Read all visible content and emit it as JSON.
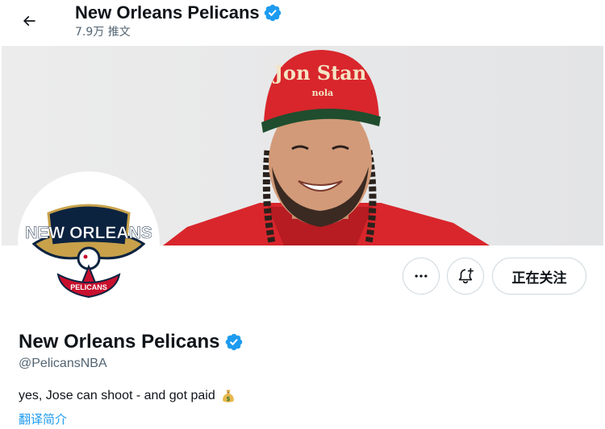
{
  "header": {
    "title": "New Orleans Pelicans",
    "tweet_count": "7.9万 推文",
    "icons": {
      "back": "back-arrow-icon",
      "verified": "verified-badge-icon"
    }
  },
  "banner": {
    "cap_text_line1": "Jon Stan",
    "cap_text_line2": "nola"
  },
  "avatar": {
    "logo_text": "NEW ORLEANS",
    "logo_sub": "PELICANS"
  },
  "actions": {
    "more_icon": "more-horizontal-icon",
    "notify_icon": "bell-plus-icon",
    "follow_label": "正在关注"
  },
  "profile": {
    "name": "New Orleans Pelicans",
    "handle": "@PelicansNBA",
    "bio": "yes, Jose can shoot - and got paid",
    "bio_emoji": "money-bag-icon",
    "translate_label": "翻译简介"
  },
  "colors": {
    "accent": "#1d9bf0",
    "text": "#0f1419",
    "secondary": "#536471",
    "border": "#cfd9de"
  }
}
